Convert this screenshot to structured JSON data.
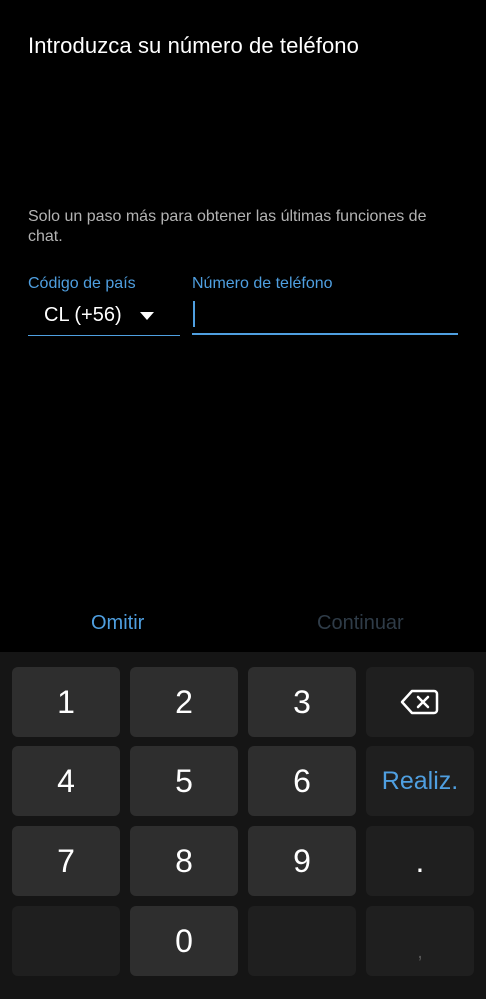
{
  "header": {
    "title": "Introduzca su número de teléfono",
    "subtitle": "Solo un paso más para obtener las últimas funciones de chat."
  },
  "form": {
    "country_label": "Código de país",
    "country_value": "CL (+56)",
    "phone_label": "Número de teléfono",
    "phone_value": ""
  },
  "actions": {
    "skip_label": "Omitir",
    "continue_label": "Continuar"
  },
  "keyboard": {
    "keys": {
      "k1": "1",
      "k2": "2",
      "k3": "3",
      "k4": "4",
      "k5": "5",
      "k6": "6",
      "k7": "7",
      "k8": "8",
      "k9": "9",
      "k0": "0",
      "done": "Realiz.",
      "period": ".",
      "comma": ","
    },
    "backspace_icon": "backspace-icon"
  },
  "colors": {
    "accent": "#4f9fe0",
    "background": "#000000",
    "keyboard_bg": "#151515",
    "key_bg": "#2e2e2e",
    "disabled_text": "#2f3c48"
  }
}
